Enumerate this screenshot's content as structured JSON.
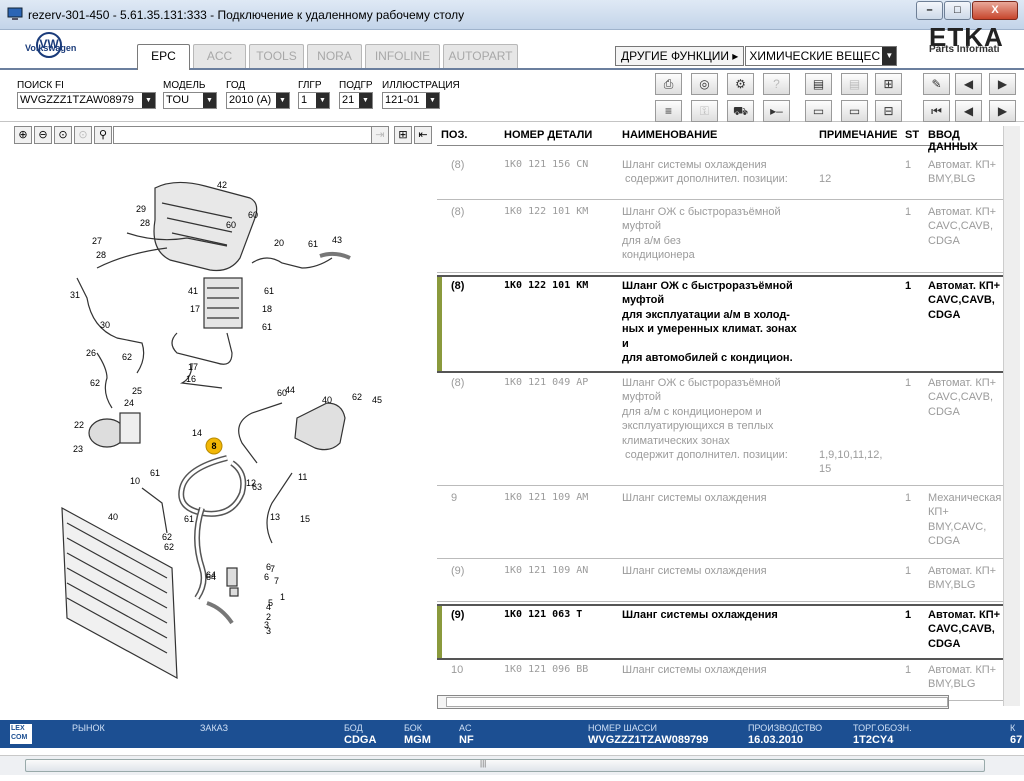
{
  "window": {
    "title": "rezerv-301-450 - 5.61.35.131:333 - Подключение к удаленному рабочему столу",
    "minimize": "–",
    "maximize": "□",
    "close": "X"
  },
  "brand": {
    "logo_text": "VW",
    "name": "Volkswagen",
    "etka": "ETKA",
    "etka_sub": "Parts Informati"
  },
  "tabs": [
    "EPC",
    "ACC",
    "TOOLS",
    "NORA",
    "INFOLINE",
    "AUTOPART"
  ],
  "functions": {
    "other_label": "ДРУГИЕ ФУНКЦИИ ▸",
    "selected": "ХИМИЧЕСКИЕ ВЕЩЕС"
  },
  "search": {
    "fi_label": "ПОИСК FI",
    "fi_value": "WVGZZZ1TZAW08979",
    "model_label": "МОДЕЛЬ",
    "model_value": "TOU",
    "year_label": "ГОД",
    "year_value": "2010 (A)",
    "glgr_label": "ГЛГР",
    "glgr_value": "1",
    "podgr_label": "ПОДГР",
    "podgr_value": "21",
    "illus_label": "ИЛЛЮСТРАЦИЯ",
    "illus_value": "121-01"
  },
  "table": {
    "headers": {
      "pos": "ПОЗ.",
      "part": "НОМЕР ДЕТАЛИ",
      "name": "НАИМЕНОВАНИЕ",
      "note": "ПРИМЕЧАНИЕ",
      "st": "ST",
      "entry": "ВВОД ДАННЫХ"
    },
    "rows": [
      {
        "pos": "(8)",
        "part": "1K0 121 156 CN",
        "name": [
          "Шланг системы охлаждения",
          " содержит дополнител. позиции:"
        ],
        "note": [
          "",
          "12"
        ],
        "st": "1",
        "entry": [
          "Автомат. КП+",
          "BMY,BLG"
        ],
        "bold": false
      },
      {
        "pos": "(8)",
        "part": "1K0 122 101 KM",
        "name": [
          "Шланг ОЖ с быстроразъёмной",
          "муфтой",
          "для а/м без",
          "кондиционера"
        ],
        "note": [],
        "st": "1",
        "entry": [
          "Автомат. КП+",
          "CAVC,CAVB,",
          "CDGA"
        ],
        "bold": false
      },
      {
        "pos": "(8)",
        "part": "1K0 122 101 KM",
        "name": [
          "Шланг ОЖ с быстроразъёмной",
          "муфтой",
          "для эксплуатации а/м в холод-",
          "ных и умеренных климат. зонах",
          "и",
          "для автомобилей с кондицион."
        ],
        "note": [],
        "st": "1",
        "entry": [
          "Автомат. КП+",
          "CAVC,CAVB,",
          "CDGA"
        ],
        "bold": true
      },
      {
        "pos": "(8)",
        "part": "1K0 121 049 AP",
        "name": [
          "Шланг ОЖ с быстроразъёмной",
          "муфтой",
          "для а/м с кондиционером и",
          "эксплуатирующихся в теплых",
          "климатических зонах",
          " содержит дополнител. позиции:"
        ],
        "note": [
          "",
          "",
          "",
          "",
          "",
          "1,9,10,11,12,",
          "15"
        ],
        "st": "1",
        "entry": [
          "Автомат. КП+",
          "CAVC,CAVB,",
          "CDGA"
        ],
        "bold": false
      },
      {
        "pos": "9",
        "part": "1K0 121 109 AM",
        "name": [
          "Шланг системы охлаждения"
        ],
        "note": [],
        "st": "1",
        "entry": [
          "Механическая",
          "КП+",
          "BMY,CAVC,",
          "CDGA"
        ],
        "bold": false
      },
      {
        "pos": "(9)",
        "part": "1K0 121 109 AN",
        "name": [
          "Шланг системы охлаждения"
        ],
        "note": [],
        "st": "1",
        "entry": [
          "Автомат. КП+",
          "BMY,BLG"
        ],
        "bold": false
      },
      {
        "pos": "(9)",
        "part": "1K0 121 063 T",
        "name": [
          "Шланг системы охлаждения"
        ],
        "note": [],
        "st": "1",
        "entry": [
          "Автомат. КП+",
          "CAVC,CAVB,",
          "CDGA"
        ],
        "bold": true
      },
      {
        "pos": "10",
        "part": "1K0 121 096 BB",
        "name": [
          "Шланг системы охлаждения"
        ],
        "note": [],
        "st": "1",
        "entry": [
          "Автомат. КП+",
          "BMY,BLG"
        ],
        "bold": false
      }
    ]
  },
  "status": {
    "lexcom": "LEX COM",
    "market_label": "РЫНОК",
    "order_label": "ЗАКАЗ",
    "bod_label": "БОД",
    "bod_value": "CDGA",
    "bok_label": "БОК",
    "bok_value": "MGM",
    "ac_label": "AC",
    "ac_value": "NF",
    "chassis_label": "НОМЕР ШАССИ",
    "chassis_value": "WVGZZZ1TZAW089799",
    "prod_label": "ПРОИЗВОДСТВО",
    "prod_value": "16.03.2010",
    "trade_label": "ТОРГ.ОБОЗН.",
    "trade_value": "1T2CY4",
    "k_label": "К",
    "k_value": "67"
  },
  "diagram": {
    "callouts": [
      "42",
      "29",
      "28",
      "60",
      "27",
      "28",
      "31",
      "30",
      "26",
      "62",
      "62",
      "25",
      "24",
      "22",
      "23",
      "60",
      "20",
      "61",
      "43",
      "41",
      "61",
      "17",
      "18",
      "61",
      "17",
      "16",
      "44",
      "60",
      "40",
      "62",
      "45",
      "14",
      "8",
      "63",
      "12",
      "11",
      "61",
      "10",
      "13",
      "61",
      "62",
      "15",
      "40",
      "62",
      "7",
      "64",
      "6",
      "3",
      "5",
      "1",
      "4",
      "2",
      "3",
      "6",
      "7",
      "64"
    ],
    "highlight": "8"
  },
  "colors": {
    "status_bg": "#1c4f92",
    "highlight": "#f2b705",
    "row_marker": "#8a9a3c"
  }
}
